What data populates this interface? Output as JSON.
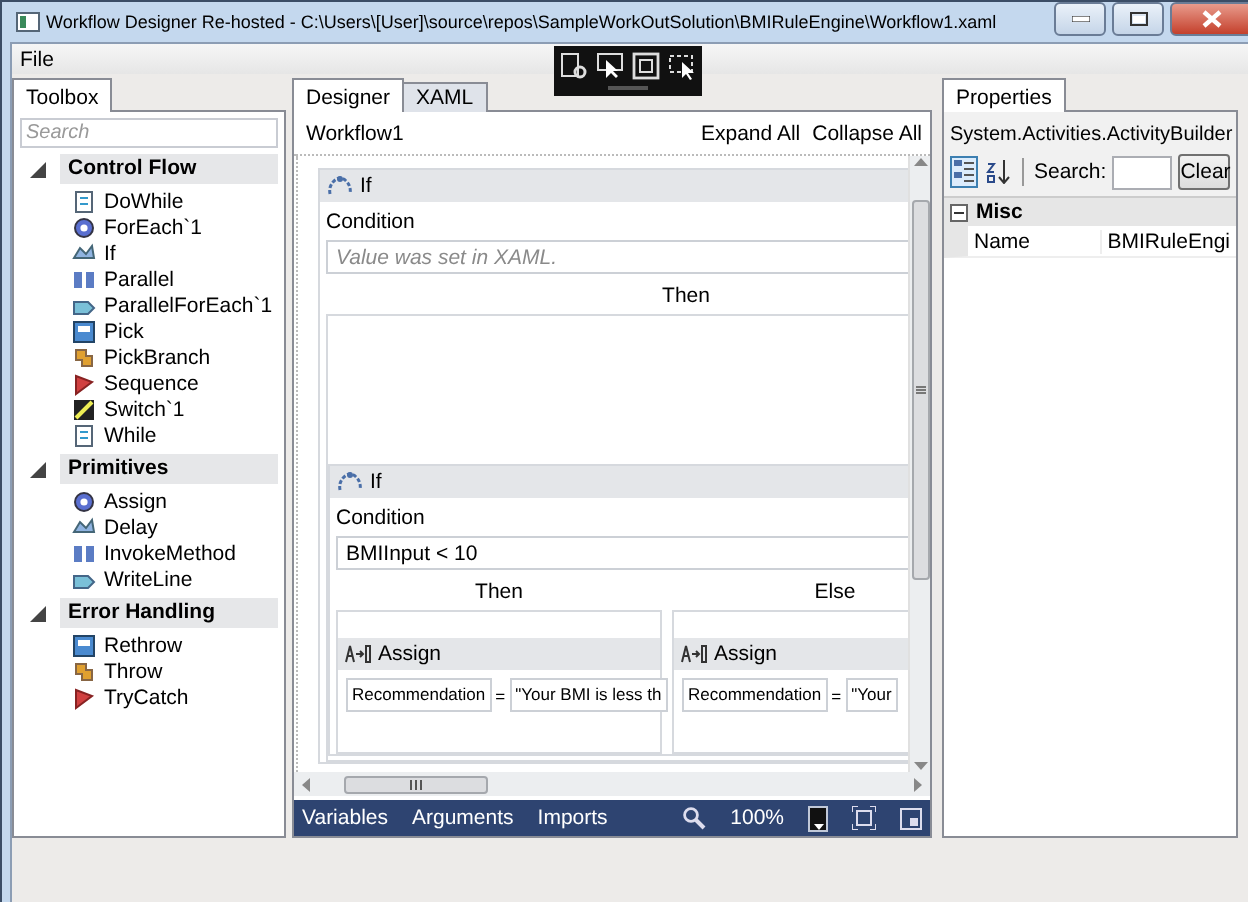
{
  "window": {
    "title": "Workflow Designer Re-hosted - C:\\Users\\[User]\\source\\repos\\SampleWorkOutSolution\\BMIRuleEngine\\Workflow1.xaml"
  },
  "menu": [
    "File"
  ],
  "toolbox": {
    "tab": "Toolbox",
    "search": {
      "placeholder": "Search"
    },
    "categories": [
      {
        "name": "Control Flow",
        "expanded": true,
        "items": [
          "DoWhile",
          "ForEach`1",
          "If",
          "Parallel",
          "ParallelForEach`1",
          "Pick",
          "PickBranch",
          "Sequence",
          "Switch`1",
          "While"
        ]
      },
      {
        "name": "Primitives",
        "expanded": true,
        "items": [
          "Assign",
          "Delay",
          "InvokeMethod",
          "WriteLine"
        ]
      },
      {
        "name": "Error Handling",
        "expanded": true,
        "items": [
          "Rethrow",
          "Throw",
          "TryCatch"
        ]
      }
    ]
  },
  "designer": {
    "tabs": [
      {
        "label": "Designer",
        "selected": true
      },
      {
        "label": "XAML",
        "selected": false
      }
    ],
    "breadcrumb": "Workflow1",
    "actions": [
      "Expand All",
      "Collapse All"
    ],
    "root": {
      "kind": "if",
      "title": "If",
      "condition_label": "Condition",
      "condition": {
        "placeholder": "Value was set in XAML."
      },
      "then_label": "Then",
      "then": {
        "kind": "if",
        "title": "If",
        "condition_label": "Condition",
        "condition": {
          "value": "BMIInput < 10"
        },
        "then_label": "Then",
        "else_label": "Else",
        "then": {
          "kind": "assign",
          "title": "Assign",
          "to": "Recommendation",
          "operator": "=",
          "value": "\"Your BMI is less th"
        },
        "else": {
          "kind": "assign",
          "title": "Assign",
          "to": "Recommendation",
          "operator": "=",
          "value": "\"Your"
        }
      }
    },
    "bottom_bar": {
      "tabs": [
        "Variables",
        "Arguments",
        "Imports"
      ],
      "zoom": "100%"
    }
  },
  "properties": {
    "tab": "Properties",
    "type_name": "System.Activities.ActivityBuilder",
    "sort_buttons": [
      {
        "kind": "categorized",
        "selected": true
      },
      {
        "kind": "alphabetical",
        "selected": false
      }
    ],
    "search_label": "Search:",
    "clear_button": "Clear",
    "categories": [
      {
        "name": "Misc",
        "expanded": true,
        "rows": [
          {
            "name": "Name",
            "value": "BMIRuleEngi"
          }
        ]
      }
    ]
  }
}
